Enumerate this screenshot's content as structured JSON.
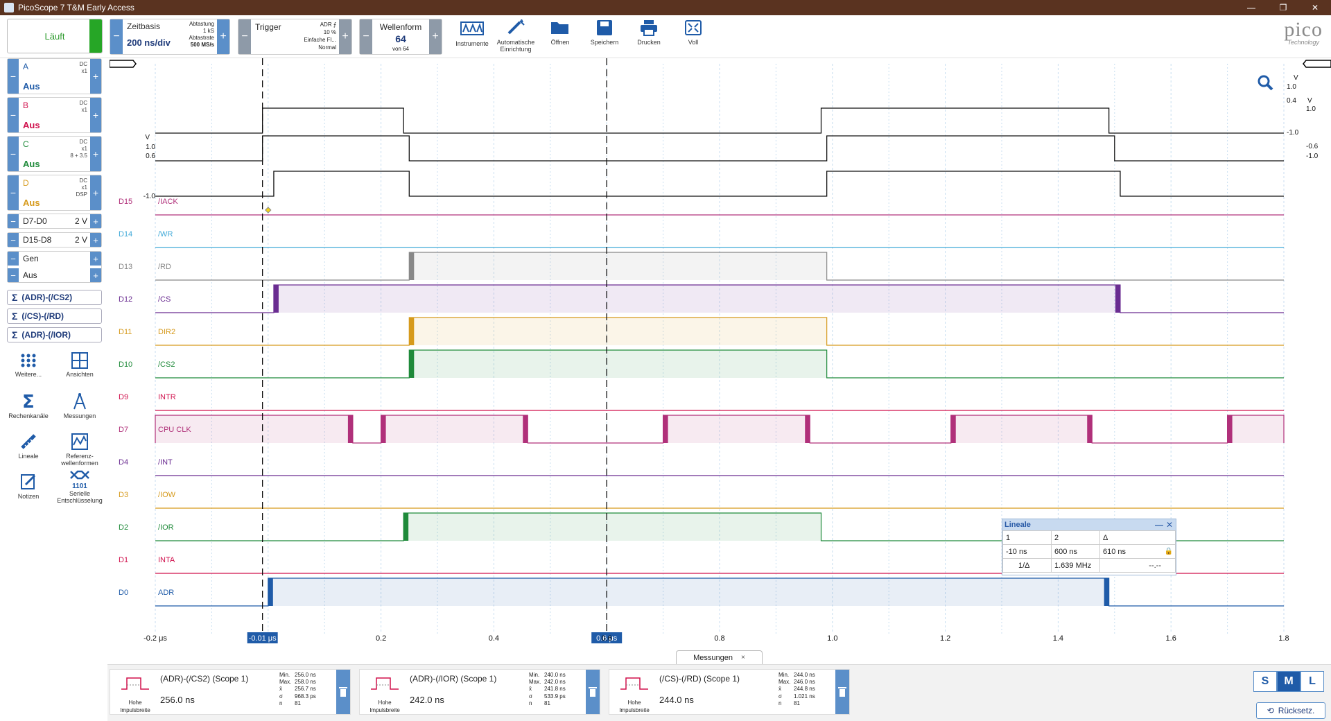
{
  "window": {
    "title": "PicoScope 7 T&M Early Access",
    "buttons": [
      "—",
      "❐",
      "✕"
    ]
  },
  "toolbar": {
    "run_label": "Läuft",
    "zeitbasis": {
      "label": "Zeitbasis",
      "value": "200 ns/div",
      "abtastung_label": "Abtastung",
      "abtastung_value": "1 kS",
      "abtastrate_label": "Abtastrate",
      "abtastrate_value": "500 MS/s"
    },
    "trigger": {
      "label": "Trigger",
      "source": "ADR",
      "level": "10 %",
      "mode_type": "Einfache Fl...",
      "mode": "Normal"
    },
    "wellenform": {
      "label": "Wellenform",
      "value": "64",
      "of": "von 64"
    },
    "tools": [
      {
        "label": "Instrumente",
        "icon": "instruments-icon"
      },
      {
        "label": "Automatische Einrichtung",
        "icon": "auto-setup-icon"
      },
      {
        "label": "Öffnen",
        "icon": "open-folder-icon"
      },
      {
        "label": "Speichern",
        "icon": "save-icon"
      },
      {
        "label": "Drucken",
        "icon": "print-icon"
      },
      {
        "label": "Voll",
        "icon": "fullscreen-icon"
      }
    ],
    "logo": {
      "big": "pico",
      "small": "Technology"
    }
  },
  "channels": [
    {
      "name": "A",
      "status": "Aus",
      "coupling": [
        "DC",
        "x1"
      ],
      "color": "#1f5ba8"
    },
    {
      "name": "B",
      "status": "Aus",
      "coupling": [
        "DC",
        "x1"
      ],
      "color": "#d0104c"
    },
    {
      "name": "C",
      "status": "Aus",
      "coupling": [
        "DC",
        "x1",
        "8 + 3.5"
      ],
      "color": "#1f8a3a"
    },
    {
      "name": "D",
      "status": "Aus",
      "coupling": [
        "DC",
        "x1",
        "DSP"
      ],
      "color": "#d69a1c"
    }
  ],
  "digital_groups": [
    {
      "name": "D7-D0",
      "value": "2 V"
    },
    {
      "name": "D15-D8",
      "value": "2 V"
    }
  ],
  "generator": {
    "name": "Gen",
    "status": "Aus"
  },
  "math_channels": [
    "(ADR)-(/CS2)",
    "(/CS)-(/RD)",
    "(ADR)-(/IOR)"
  ],
  "side_tools": [
    {
      "label": "Weitere...",
      "icon": "more-dots-icon"
    },
    {
      "label": "Ansichten",
      "icon": "views-grid-icon"
    },
    {
      "label": "Rechenkanäle",
      "icon": "math-sigma-icon"
    },
    {
      "label": "Messungen",
      "icon": "measurements-icon"
    },
    {
      "label": "Lineale",
      "icon": "ruler-icon"
    },
    {
      "label": "Referenz-wellenformen",
      "icon": "reference-waveform-icon"
    },
    {
      "label": "Notizen",
      "icon": "notes-icon"
    },
    {
      "label": "Serielle Entschlüsselung",
      "icon": "serial-decode-icon",
      "extra": "1101"
    }
  ],
  "scope": {
    "x_axis": {
      "min": -0.2,
      "max": 1.8,
      "unit": "μs",
      "ticks": [
        "-0.2 μs",
        "0",
        "0.2",
        "0.4",
        "0.6",
        "0.8",
        "1.0",
        "1.2",
        "1.4",
        "1.6",
        "1.8"
      ]
    },
    "analog_labels_left": {
      "unit": "V",
      "top": "1.0",
      "mid": "0.6",
      "bottom": "-1.0"
    },
    "analog_labels_right": {
      "unit1": "V",
      "v1": "1.0",
      "v2": "0.4",
      "unit2": "V",
      "v3": "1.0",
      "v4": "-1.0",
      "v5": "-0.6",
      "v6": "-1.0"
    },
    "rulers": [
      {
        "label": "-0.01 μs",
        "t": -0.01
      },
      {
        "label": "0.6 μs",
        "t": 0.6
      }
    ],
    "analog_traces": [
      {
        "name": "math-1",
        "low_before": -0.01,
        "high_until": 0.24,
        "high_again": 0.98,
        "high_end": 1.49
      },
      {
        "name": "math-2",
        "low_before": -0.01,
        "high_until": 0.25,
        "high_again": 0.99,
        "high_end": 1.5
      },
      {
        "name": "math-3",
        "low_before": 0.01,
        "high_until": 0.25,
        "high_again": 0.99,
        "high_end": 1.51
      }
    ],
    "digital_channels": [
      {
        "id": "D15",
        "name": "/IACK",
        "color": "#b0307a",
        "pulses": []
      },
      {
        "id": "D14",
        "name": "/WR",
        "color": "#3fa9d8",
        "pulses": []
      },
      {
        "id": "D13",
        "name": "/RD",
        "color": "#888888",
        "pulses": [
          [
            0.25,
            0.99
          ]
        ]
      },
      {
        "id": "D12",
        "name": "/CS",
        "color": "#6a2c91",
        "pulses": [
          [
            0.01,
            1.51
          ]
        ]
      },
      {
        "id": "D11",
        "name": "DIR2",
        "color": "#d69a1c",
        "pulses": [
          [
            0.25,
            0.99
          ]
        ]
      },
      {
        "id": "D10",
        "name": "/CS2",
        "color": "#1f8a3a",
        "pulses": [
          [
            0.25,
            0.99
          ]
        ]
      },
      {
        "id": "D9",
        "name": "INTR",
        "color": "#d0104c",
        "pulses": []
      },
      {
        "id": "D7",
        "name": "CPU CLK",
        "color": "#b0307a",
        "pulses": [
          [
            -0.2,
            0.15
          ],
          [
            0.2,
            0.46
          ],
          [
            0.7,
            0.96
          ],
          [
            1.21,
            1.46
          ],
          [
            1.7,
            1.8
          ]
        ]
      },
      {
        "id": "D4",
        "name": "/INT",
        "color": "#6a2c91",
        "pulses": []
      },
      {
        "id": "D3",
        "name": "/IOW",
        "color": "#d69a1c",
        "pulses": []
      },
      {
        "id": "D2",
        "name": "/IOR",
        "color": "#1f8a3a",
        "pulses": [
          [
            0.24,
            0.98
          ]
        ]
      },
      {
        "id": "D1",
        "name": "INTA",
        "color": "#d0104c",
        "pulses": []
      },
      {
        "id": "D0",
        "name": "ADR",
        "color": "#1f5ba8",
        "pulses": [
          [
            0.0,
            1.49
          ]
        ]
      }
    ]
  },
  "lineale": {
    "title": "Lineale",
    "headers": [
      "1",
      "2",
      "Δ"
    ],
    "values": [
      "-10 ns",
      "600 ns",
      "610 ns"
    ],
    "freq_label": "1/Δ",
    "freq_value": "1.639 MHz",
    "extra": "--.--"
  },
  "measurements_tab": {
    "label": "Messungen",
    "close": "×"
  },
  "measurements": [
    {
      "title": "(ADR)-(/CS2) (Scope 1)",
      "value": "256.0 ns",
      "type": "Hohe Impulsbreite",
      "stats": [
        [
          "Min.",
          "256.0 ns"
        ],
        [
          "Max.",
          "258.0 ns"
        ],
        [
          "x̄",
          "256.7 ns"
        ],
        [
          "σ",
          "968.3 ps"
        ],
        [
          "n",
          "81"
        ]
      ]
    },
    {
      "title": "(ADR)-(/IOR) (Scope 1)",
      "value": "242.0 ns",
      "type": "Hohe Impulsbreite",
      "stats": [
        [
          "Min.",
          "240.0 ns"
        ],
        [
          "Max.",
          "242.0 ns"
        ],
        [
          "x̄",
          "241.8 ns"
        ],
        [
          "σ",
          "533.9 ps"
        ],
        [
          "n",
          "81"
        ]
      ]
    },
    {
      "title": "(/CS)-(/RD) (Scope 1)",
      "value": "244.0 ns",
      "type": "Hohe Impulsbreite",
      "stats": [
        [
          "Min.",
          "244.0 ns"
        ],
        [
          "Max.",
          "246.0 ns"
        ],
        [
          "x̄",
          "244.8 ns"
        ],
        [
          "σ",
          "1.021 ns"
        ],
        [
          "n",
          "81"
        ]
      ]
    }
  ],
  "size_buttons": [
    "S",
    "M",
    "L"
  ],
  "size_selected": "M",
  "reset_label": "Rücksetz."
}
